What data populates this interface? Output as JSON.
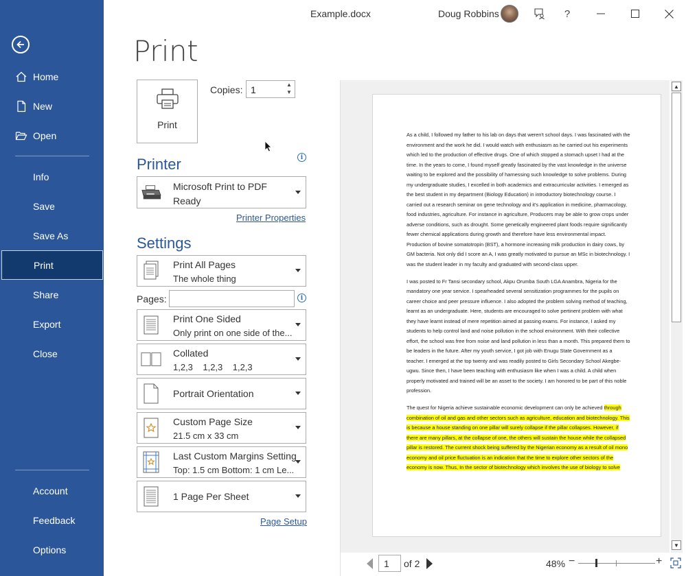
{
  "window": {
    "doc_title": "Example.docx",
    "user_name": "Doug Robbins",
    "icons": [
      "coauthoring-icon",
      "help-icon",
      "minimize-icon",
      "maximize-icon",
      "close-icon"
    ],
    "help_glyph": "?"
  },
  "sidebar": {
    "back_icon": "back-arrow-icon",
    "items_top": [
      {
        "label": "Home",
        "icon": "home-icon"
      },
      {
        "label": "New",
        "icon": "new-doc-icon"
      },
      {
        "label": "Open",
        "icon": "folder-open-icon"
      }
    ],
    "items_mid": [
      "Info",
      "Save",
      "Save As",
      "Print",
      "Share",
      "Export",
      "Close"
    ],
    "active": "Print",
    "items_bottom": [
      "Account",
      "Feedback",
      "Options"
    ],
    "accent": "#2b579a"
  },
  "print": {
    "heading": "Print",
    "button_label": "Print",
    "copies_label": "Copies:",
    "copies_value": "1",
    "printer_title": "Printer",
    "printer": {
      "name": "Microsoft Print to PDF",
      "status": "Ready"
    },
    "printer_properties": "Printer Properties",
    "settings_title": "Settings",
    "settings": [
      {
        "main": "Print All Pages",
        "sub": "The whole thing",
        "icon": "pages-icon"
      },
      {
        "main": "Print One Sided",
        "sub": "Only print on one side of the...",
        "icon": "one-sided-icon"
      },
      {
        "main": "Collated",
        "sub": "1,2,3    1,2,3    1,2,3",
        "icon": "collated-icon"
      },
      {
        "main": "Portrait Orientation",
        "sub": "",
        "icon": "portrait-icon"
      },
      {
        "main": "Custom Page Size",
        "sub": "21.5 cm x 33 cm",
        "icon": "page-size-icon"
      },
      {
        "main": "Last Custom Margins Setting",
        "sub": "Top: 1.5 cm Bottom: 1 cm Le...",
        "icon": "margins-icon"
      },
      {
        "main": "1 Page Per Sheet",
        "sub": "",
        "icon": "pages-per-sheet-icon"
      }
    ],
    "pages_label": "Pages:",
    "pages_value": "",
    "page_setup": "Page Setup",
    "info_glyph": "i"
  },
  "preview": {
    "paragraphs": [
      {
        "text": "As a child, I followed my father to his lab on days that weren't school days. I was fascinated with the environment and the work he did. I would watch with enthusiasm as he carried out his experiments which led to the production of effective drugs. One of which stopped a stomach upset I had at the time. In the years to come, I found myself greatly fascinated by the vast knowledge in the universe waiting to be explored and the possibility of harnessing such knowledge to solve problems. During my undergraduate studies, I excelled in both academics and extracurricular activities. I emerged as the best student in my department (Biology Education) in introductory biotechnology course. I carried out a research seminar on gene technology and it's application in medicine, pharmacology, food industries, agriculture. For instance in agriculture, Producers may be able to grow crops under adverse conditions, such as drought. Some genetically engineered plant foods require significantly fewer chemical applications during growth and therefore have less environmental impact. Production of bovine somatotropin (BST), a hormone increasing milk production in dairy cows, by GM bacteria. Not only did I score an A, I was greatly motivated to pursue an MSc in biotechnology. I was the student leader in my faculty and graduated with second-class upper."
      },
      {
        "text": "I was posted to Fr Tansi secondary school, Akpu Orumba South LGA Anambra, Nigeria for the mandatory one year service. I spearheaded several sensitization programmes for the pupils on career choice and peer pressure influence. I also adopted the problem solving method of teaching, learnt as an undergraduate. Here, students are encouraged to solve pertinent problem with what they have learnt instead of mere repetition aimed at passing exams. For instance, I asked my students to help control land and noise pollution in the school environment. With their collective effort, the school was free from noise and land pollution in less than a month. This prepared them to be leaders in the future. After my youth service, I got job with Enugu State Government as a teacher. I emerged at the top twenty and was readily posted to Girls Secondary School Akegbe-ugwu. Since then, I have been teaching with enthusiasm like when I was a child. A child when properly motivated and trained will be an asset to the society. I am honored to be part of this noble profession."
      }
    ],
    "para3_plain": "The quest for Nigeria achieve sustainable economic development can only be achieved",
    "para3_highlighted": "through combination of oil and gas and other sectors such as agriculture, education and biotechnology. This is because a house standing on one pillar will surely collapse if the pillar collapses. However, if there are many pillars, at the collapse of one, the others will sustain the house while the collapsed pillar is restored. The current shock being suffered by the Nigerian economy as a result of oil mono economy and oil price fluctuation is an indication that the time to explore other sectors of the economy is now. Thus, In the sector of biotechnology which involves the use of biology to solve",
    "highlight_color": "#ffff00",
    "current_page": "1",
    "page_of": "of 2",
    "zoom": "48%",
    "zoom_minus": "−",
    "zoom_plus": "+",
    "zoom_fraction": 0.48
  }
}
